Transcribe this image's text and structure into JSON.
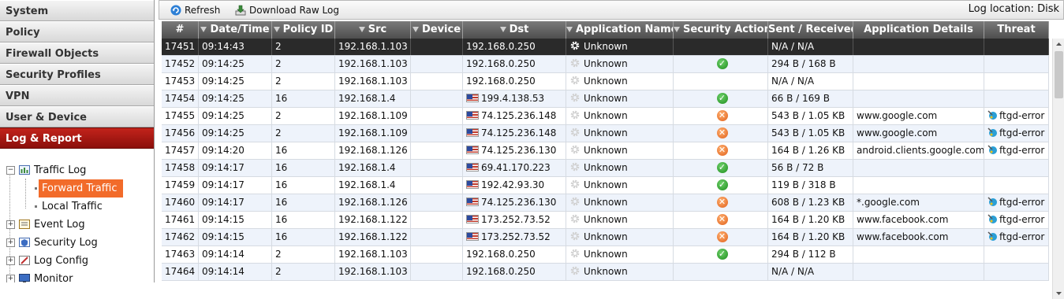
{
  "sidebar": {
    "items": [
      {
        "label": "System",
        "active": false
      },
      {
        "label": "Policy",
        "active": false
      },
      {
        "label": "Firewall Objects",
        "active": false
      },
      {
        "label": "Security Profiles",
        "active": false
      },
      {
        "label": "VPN",
        "active": false
      },
      {
        "label": "User & Device",
        "active": false
      },
      {
        "label": "Log & Report",
        "active": true
      }
    ],
    "tree": {
      "traffic_log": "Traffic Log",
      "forward_traffic": "Forward Traffic",
      "local_traffic": "Local Traffic",
      "event_log": "Event Log",
      "security_log": "Security Log",
      "log_config": "Log Config",
      "monitor": "Monitor"
    }
  },
  "toolbar": {
    "refresh_label": "Refresh",
    "download_label": "Download Raw Log",
    "log_location": "Log location: Disk"
  },
  "grid": {
    "columns": [
      "#",
      "Date/Time",
      "Policy ID",
      "Src",
      "Device",
      "Dst",
      "Application Name",
      "Security Action",
      "Sent / Received",
      "Application Details",
      "Threat"
    ],
    "rows": [
      {
        "num": "17451",
        "time": "09:14:43",
        "policy": "2",
        "src": "192.168.1.103",
        "device": "",
        "flag": false,
        "dst": "192.168.0.250",
        "app": "Unknown",
        "action": "",
        "sent": "N/A / N/A",
        "details": "",
        "threat": "",
        "selected": true
      },
      {
        "num": "17452",
        "time": "09:14:25",
        "policy": "2",
        "src": "192.168.1.103",
        "device": "",
        "flag": false,
        "dst": "192.168.0.250",
        "app": "Unknown",
        "action": "pass",
        "sent": "294 B / 168 B",
        "details": "",
        "threat": ""
      },
      {
        "num": "17453",
        "time": "09:14:25",
        "policy": "2",
        "src": "192.168.1.103",
        "device": "",
        "flag": false,
        "dst": "192.168.0.250",
        "app": "Unknown",
        "action": "",
        "sent": "N/A / N/A",
        "details": "",
        "threat": ""
      },
      {
        "num": "17454",
        "time": "09:14:25",
        "policy": "16",
        "src": "192.168.1.4",
        "device": "",
        "flag": true,
        "dst": "199.4.138.53",
        "app": "Unknown",
        "action": "pass",
        "sent": "66 B / 169 B",
        "details": "",
        "threat": ""
      },
      {
        "num": "17455",
        "time": "09:14:25",
        "policy": "2",
        "src": "192.168.1.109",
        "device": "",
        "flag": true,
        "dst": "74.125.236.148",
        "app": "Unknown",
        "action": "block",
        "sent": "543 B / 1.05 KB",
        "details": "www.google.com",
        "threat": "ftgd-error"
      },
      {
        "num": "17456",
        "time": "09:14:25",
        "policy": "2",
        "src": "192.168.1.109",
        "device": "",
        "flag": true,
        "dst": "74.125.236.148",
        "app": "Unknown",
        "action": "block",
        "sent": "543 B / 1.05 KB",
        "details": "www.google.com",
        "threat": "ftgd-error"
      },
      {
        "num": "17457",
        "time": "09:14:20",
        "policy": "16",
        "src": "192.168.1.126",
        "device": "",
        "flag": true,
        "dst": "74.125.236.130",
        "app": "Unknown",
        "action": "block",
        "sent": "164 B / 1.26 KB",
        "details": "android.clients.google.com",
        "threat": "ftgd-error"
      },
      {
        "num": "17458",
        "time": "09:14:17",
        "policy": "16",
        "src": "192.168.1.4",
        "device": "",
        "flag": true,
        "dst": "69.41.170.223",
        "app": "Unknown",
        "action": "pass",
        "sent": "56 B / 72 B",
        "details": "",
        "threat": ""
      },
      {
        "num": "17459",
        "time": "09:14:17",
        "policy": "16",
        "src": "192.168.1.4",
        "device": "",
        "flag": true,
        "dst": "192.42.93.30",
        "app": "Unknown",
        "action": "pass",
        "sent": "119 B / 318 B",
        "details": "",
        "threat": ""
      },
      {
        "num": "17460",
        "time": "09:14:17",
        "policy": "16",
        "src": "192.168.1.126",
        "device": "",
        "flag": true,
        "dst": "74.125.236.130",
        "app": "Unknown",
        "action": "block",
        "sent": "608 B / 1.23 KB",
        "details": "*.google.com",
        "threat": "ftgd-error"
      },
      {
        "num": "17461",
        "time": "09:14:15",
        "policy": "16",
        "src": "192.168.1.122",
        "device": "",
        "flag": true,
        "dst": "173.252.73.52",
        "app": "Unknown",
        "action": "block",
        "sent": "164 B / 1.20 KB",
        "details": "www.facebook.com",
        "threat": "ftgd-error"
      },
      {
        "num": "17462",
        "time": "09:14:15",
        "policy": "16",
        "src": "192.168.1.122",
        "device": "",
        "flag": true,
        "dst": "173.252.73.52",
        "app": "Unknown",
        "action": "block",
        "sent": "164 B / 1.20 KB",
        "details": "www.facebook.com",
        "threat": "ftgd-error"
      },
      {
        "num": "17463",
        "time": "09:14:14",
        "policy": "2",
        "src": "192.168.1.103",
        "device": "",
        "flag": false,
        "dst": "192.168.0.250",
        "app": "Unknown",
        "action": "pass",
        "sent": "294 B / 112 B",
        "details": "",
        "threat": ""
      },
      {
        "num": "17464",
        "time": "09:14:14",
        "policy": "2",
        "src": "192.168.1.103",
        "device": "",
        "flag": false,
        "dst": "192.168.0.250",
        "app": "Unknown",
        "action": "",
        "sent": "N/A / N/A",
        "details": "",
        "threat": ""
      }
    ]
  },
  "colors": {
    "accent": "#f26b2a",
    "active_nav": "#b01a14",
    "header": "#5c5c5c",
    "pass": "#2aa02a",
    "block": "#e8641e"
  }
}
